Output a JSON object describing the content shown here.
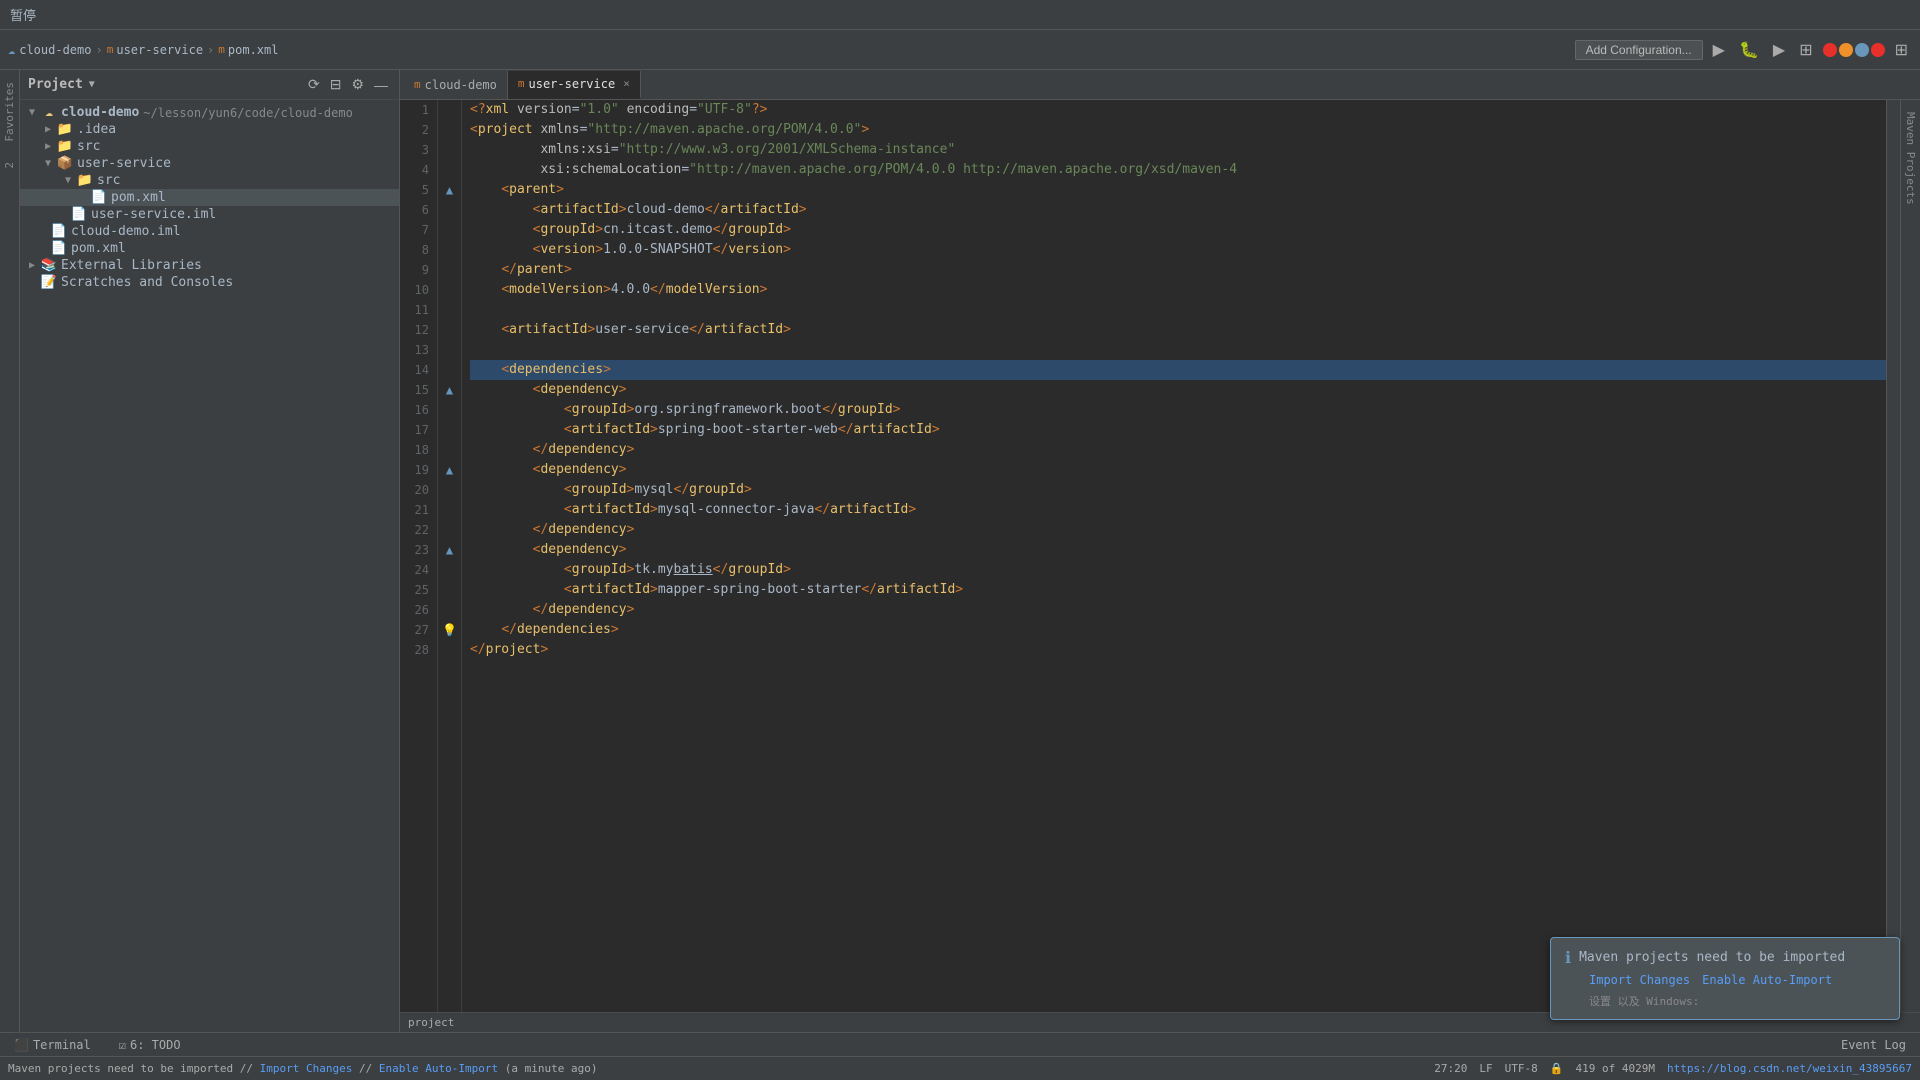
{
  "titleBar": {
    "text": "暂停"
  },
  "appName": "cloud-demo",
  "breadcrumb": {
    "items": [
      "cloud-demo",
      "user-service",
      "pom.xml"
    ],
    "separators": [
      ">",
      ">"
    ]
  },
  "toolbar": {
    "addConfigBtn": "Add Configuration...",
    "runIcon": "▶",
    "debugIcon": "🐛"
  },
  "projectPanel": {
    "title": "Project",
    "dropdownIcon": "▼",
    "settingsIcon": "⚙",
    "collapseIcon": "—"
  },
  "tabs": {
    "items": [
      {
        "label": "cloud-demo",
        "icon": "m",
        "active": false,
        "closable": false
      },
      {
        "label": "user-service",
        "icon": "m",
        "active": true,
        "closable": true
      }
    ]
  },
  "fileTree": {
    "items": [
      {
        "indent": 0,
        "arrow": "▼",
        "icon": "📁",
        "label": "cloud-demo",
        "hint": "~/lesson/yun6/code/cloud-demo",
        "type": "root"
      },
      {
        "indent": 1,
        "arrow": "▼",
        "icon": "📁",
        "label": ".idea",
        "hint": "",
        "type": "dir"
      },
      {
        "indent": 1,
        "arrow": "▶",
        "icon": "📁",
        "label": "src",
        "hint": "",
        "type": "dir"
      },
      {
        "indent": 1,
        "arrow": "▼",
        "icon": "📦",
        "label": "user-service",
        "hint": "",
        "type": "dir",
        "module": true
      },
      {
        "indent": 2,
        "arrow": "▼",
        "icon": "📁",
        "label": "src",
        "hint": "",
        "type": "dir"
      },
      {
        "indent": 3,
        "arrow": "",
        "icon": "📄",
        "label": "pom.xml",
        "hint": "",
        "type": "xml",
        "selected": true
      },
      {
        "indent": 2,
        "arrow": "",
        "icon": "📄",
        "label": "user-service.iml",
        "hint": "",
        "type": "iml"
      },
      {
        "indent": 1,
        "arrow": "",
        "icon": "📄",
        "label": "cloud-demo.iml",
        "hint": "",
        "type": "iml"
      },
      {
        "indent": 1,
        "arrow": "",
        "icon": "📄",
        "label": "pom.xml",
        "hint": "",
        "type": "xml"
      },
      {
        "indent": 0,
        "arrow": "▶",
        "icon": "📚",
        "label": "External Libraries",
        "hint": "",
        "type": "dir"
      },
      {
        "indent": 0,
        "arrow": "",
        "icon": "📝",
        "label": "Scratches and Consoles",
        "hint": "",
        "type": "dir"
      }
    ]
  },
  "code": {
    "lines": [
      {
        "num": 1,
        "gutter": "",
        "content": "<?xml version=\"1.0\" encoding=\"UTF-8\"?>"
      },
      {
        "num": 2,
        "gutter": "",
        "content": "<project xmlns=\"http://maven.apache.org/POM/4.0.0\""
      },
      {
        "num": 3,
        "gutter": "",
        "content": "         xmlns:xsi=\"http://www.w3.org/2001/XMLSchema-instance\""
      },
      {
        "num": 4,
        "gutter": "",
        "content": "         xsi:schemaLocation=\"http://maven.apache.org/POM/4.0.0 http://maven.apache.org/xsd/maven-4"
      },
      {
        "num": 5,
        "gutter": "▲",
        "content": "    <parent>"
      },
      {
        "num": 6,
        "gutter": "",
        "content": "        <artifactId>cloud-demo</artifactId>"
      },
      {
        "num": 7,
        "gutter": "",
        "content": "        <groupId>cn.itcast.demo</groupId>"
      },
      {
        "num": 8,
        "gutter": "",
        "content": "        <version>1.0.0-SNAPSHOT</version>"
      },
      {
        "num": 9,
        "gutter": "",
        "content": "    </parent>"
      },
      {
        "num": 10,
        "gutter": "",
        "content": "    <modelVersion>4.0.0</modelVersion>"
      },
      {
        "num": 11,
        "gutter": "",
        "content": ""
      },
      {
        "num": 12,
        "gutter": "",
        "content": "    <artifactId>user-service</artifactId>"
      },
      {
        "num": 13,
        "gutter": "",
        "content": ""
      },
      {
        "num": 14,
        "gutter": "",
        "content": "    <dependencies>",
        "highlight": true
      },
      {
        "num": 15,
        "gutter": "▲",
        "content": "        <dependency>"
      },
      {
        "num": 16,
        "gutter": "",
        "content": "            <groupId>org.springframework.boot</groupId>"
      },
      {
        "num": 17,
        "gutter": "",
        "content": "            <artifactId>spring-boot-starter-web</artifactId>"
      },
      {
        "num": 18,
        "gutter": "",
        "content": "        </dependency>"
      },
      {
        "num": 19,
        "gutter": "▲",
        "content": "        <dependency>"
      },
      {
        "num": 20,
        "gutter": "",
        "content": "            <groupId>mysql</groupId>"
      },
      {
        "num": 21,
        "gutter": "",
        "content": "            <artifactId>mysql-connector-java</artifactId>"
      },
      {
        "num": 22,
        "gutter": "",
        "content": "        </dependency>"
      },
      {
        "num": 23,
        "gutter": "▲",
        "content": "        <dependency>"
      },
      {
        "num": 24,
        "gutter": "",
        "content": "            <groupId>tk.mybatis</groupId>"
      },
      {
        "num": 25,
        "gutter": "",
        "content": "            <artifactId>mapper-spring-boot-starter</artifactId>"
      },
      {
        "num": 26,
        "gutter": "",
        "content": "        </dependency>"
      },
      {
        "num": 27,
        "gutter": "💡",
        "content": "    </dependencies>"
      },
      {
        "num": 28,
        "gutter": "",
        "content": "</project>"
      }
    ]
  },
  "notification": {
    "icon": "ℹ",
    "message": "Maven projects need to be imported",
    "importLink": "Import Changes",
    "autoImportLink": "Enable Auto-Import",
    "extraText": "设置 以及 Windows:"
  },
  "bottomPanel": {
    "tabs": [
      {
        "icon": "⬛",
        "label": "Terminal"
      },
      {
        "icon": "☑",
        "label": "6: TODO"
      }
    ],
    "eventLog": "Event Log"
  },
  "statusBar": {
    "message": "Maven projects need to be imported // Import Changes // Enable Auto-Import (a minute ago)",
    "position": "27:20",
    "lf": "LF",
    "encoding": "UTF-8",
    "lock": "🔒",
    "git": "419 of 4029M",
    "link": "https://blog.csdn.net/weixin_43895667"
  },
  "rightStrip": {
    "labels": [
      "Maven Projects"
    ]
  },
  "leftStrip": {
    "labels": [
      "Favorites",
      "2"
    ]
  }
}
